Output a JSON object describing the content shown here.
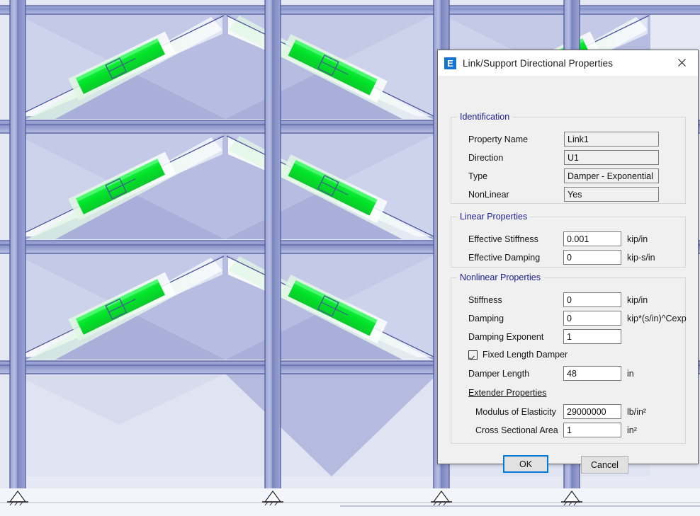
{
  "window": {
    "title": "Link/Support Directional Properties",
    "app_icon": "etabs-e-icon",
    "icon_letter": "E",
    "close_icon": "close-icon",
    "accent": "#1674d1",
    "focus_color": "#0078d7"
  },
  "groups": {
    "identification": {
      "legend": "Identification",
      "fields": [
        {
          "label": "Property Name",
          "value": "Link1",
          "readonly": true,
          "unit": ""
        },
        {
          "label": "Direction",
          "value": "U1",
          "readonly": true,
          "unit": ""
        },
        {
          "label": "Type",
          "value": "Damper - Exponential",
          "readonly": true,
          "unit": ""
        },
        {
          "label": "NonLinear",
          "value": "Yes",
          "readonly": true,
          "unit": ""
        }
      ]
    },
    "linear": {
      "legend": "Linear Properties",
      "fields": [
        {
          "label": "Effective Stiffness",
          "value": "0.001",
          "readonly": false,
          "unit": "kip/in"
        },
        {
          "label": "Effective Damping",
          "value": "0",
          "readonly": false,
          "unit": "kip-s/in"
        }
      ]
    },
    "nonlinear": {
      "legend": "Nonlinear Properties",
      "fields": [
        {
          "label": "Stiffness",
          "value": "0",
          "readonly": false,
          "unit": "kip/in"
        },
        {
          "label": "Damping",
          "value": "0",
          "readonly": false,
          "unit": "kip*(s/in)^Cexp"
        },
        {
          "label": "Damping Exponent",
          "value": "1",
          "readonly": false,
          "unit": ""
        }
      ],
      "checkbox": {
        "label": "Fixed Length Damper",
        "checked": true
      },
      "damper_length": {
        "label": "Damper Length",
        "value": "48",
        "unit": "in"
      },
      "extender": {
        "heading": "Extender Properties",
        "fields": [
          {
            "label": "Modulus of Elasticity",
            "value": "29000000",
            "unit": "lb/in²"
          },
          {
            "label": "Cross Sectional Area",
            "value": "1",
            "unit": "in²"
          }
        ]
      }
    }
  },
  "buttons": {
    "ok": "OK",
    "cancel": "Cancel"
  },
  "model": {
    "description": "3D structural frame elevation with diagonal braces and green damper link elements",
    "colors": {
      "member": "#6d78b8",
      "member_dark": "#4a5599",
      "damper": "#00e328",
      "wall_light": "#dfe3f2",
      "wall_mid": "#c3c9e6",
      "wall_dark": "#9aa4d2",
      "background": "#e6e9f4"
    },
    "bays": 3,
    "stories": 4,
    "supports": "pin-support"
  }
}
